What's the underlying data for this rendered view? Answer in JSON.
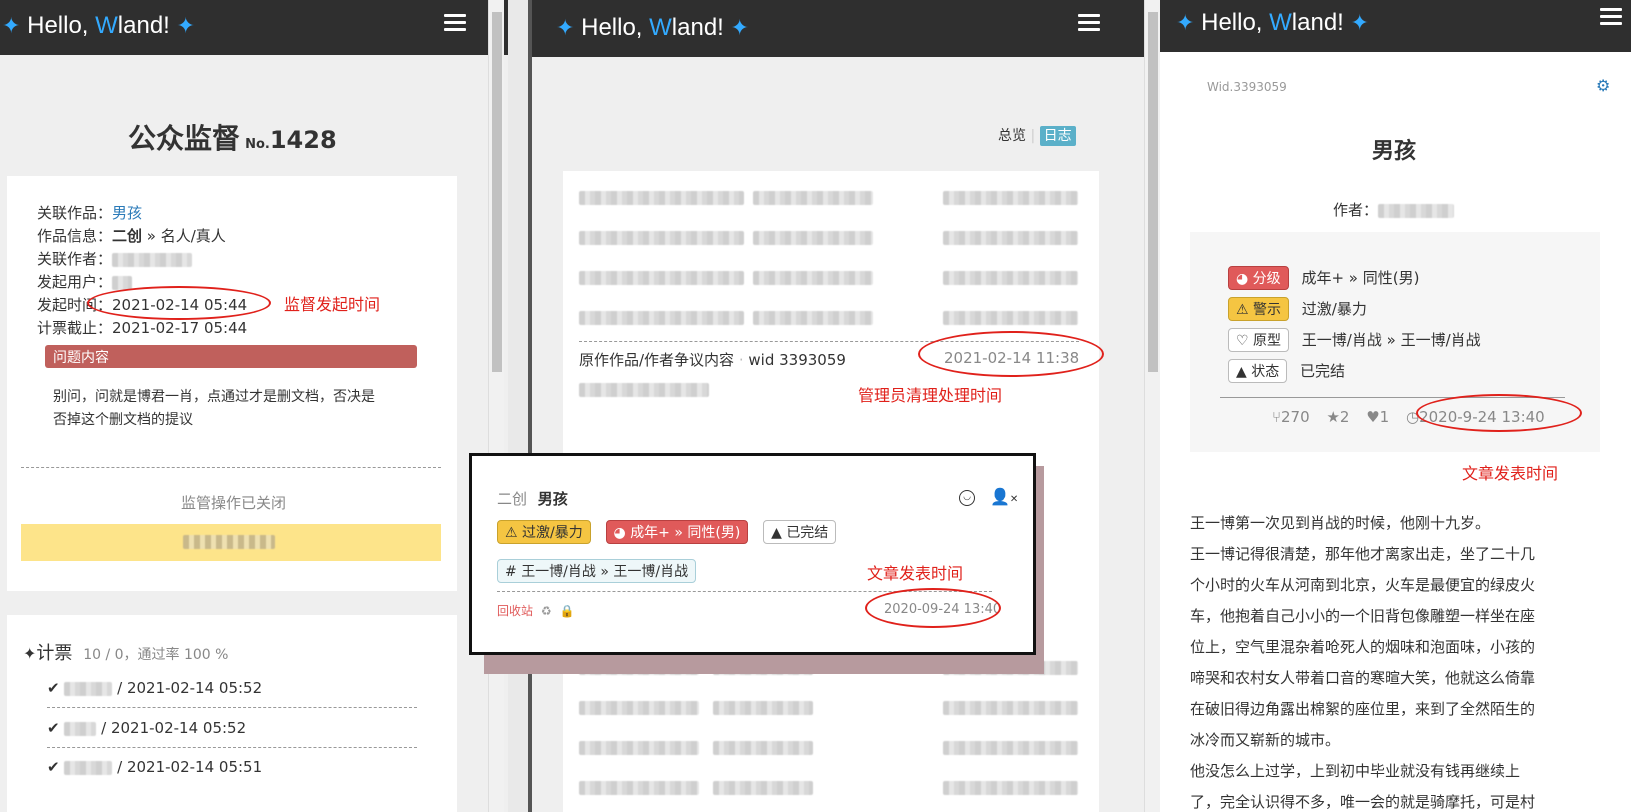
{
  "brand": {
    "hello": "Hello, ",
    "w": "W",
    "land": "land!",
    "star": "✦"
  },
  "left": {
    "title": "公众监督",
    "no_prefix": "No.",
    "no": "1428",
    "rows": [
      {
        "label": "关联作品：",
        "value": "男孩"
      },
      {
        "label": "作品信息：",
        "value": "二创",
        "extra": " » 名人/真人"
      },
      {
        "label": "关联作者：",
        "value": ""
      },
      {
        "label": "发起用户：",
        "value": ""
      },
      {
        "label": "发起时间：",
        "value": "2021-02-14 05:44"
      },
      {
        "label": "计票截止：",
        "value": "2021-02-17 05:44"
      }
    ],
    "annotation_start": "监督发起时间",
    "issue_header": "问题内容",
    "issue_text_1": "别问，问就是博君一肖，点通过才是删文档，否决是",
    "issue_text_2": "否掉这个删文档的提议",
    "closed_text": "监管操作已关闭",
    "vote_title": "计票",
    "vote_stats": "10 / 0，通过率 100 %",
    "votes": [
      {
        "time": "/ 2021-02-14 05:52"
      },
      {
        "time": "/ 2021-02-14 05:52"
      },
      {
        "time": "/ 2021-02-14 05:51"
      }
    ]
  },
  "middle": {
    "tab_overview": "总览",
    "tab_log": "日志",
    "log_entry": {
      "text": "原作作品/作者争议内容",
      "sep": "·",
      "wid": "wid 3393059",
      "time": "2021-02-14 11:38"
    },
    "annotation_admin": "管理员清理处理时间"
  },
  "popup": {
    "type": "二创",
    "title": "男孩",
    "tag_warn": "过激/暴力",
    "tag_rating": "成年+ » 同性(男)",
    "tag_status": "已完结",
    "tag_fandom": "王一博/肖战 » 王一博/肖战",
    "annotation": "文章发表时间",
    "recycle": "回收站",
    "time": "2020-09-24 13:40"
  },
  "right": {
    "wid": "Wid.3393059",
    "title": "男孩",
    "author_label": "作者：",
    "meta": [
      {
        "key": "分级",
        "value": "成年+ » 同性(男)",
        "icon": "pie-chart-icon"
      },
      {
        "key": "警示",
        "value": "过激/暴力",
        "icon": "warning-icon"
      },
      {
        "key": "原型",
        "value": "王一博/肖战 » 王一博/肖战",
        "icon": "heartbeat-icon"
      },
      {
        "key": "状态",
        "value": "已完结",
        "icon": "tree-icon"
      }
    ],
    "stats": {
      "views": "270",
      "stars": "2",
      "likes": "1",
      "time": "2020-9-24 13:40"
    },
    "annotation": "文章发表时间",
    "body": [
      "王一博第一次见到肖战的时候，他刚十九岁。",
      "王一博记得很清楚，那年他才离家出走，坐了二十几",
      "个小时的火车从河南到北京，火车是最便宜的绿皮火",
      "车，他抱着自己小小的一个旧背包像雕塑一样坐在座",
      "位上，空气里混杂着呛死人的烟味和泡面味，小孩的",
      "啼哭和农村女人带着口音的寒暄大笑，他就这么倚靠",
      "在破旧得边角露出棉絮的座位里，来到了全然陌生的",
      "冰冷而又崭新的城市。",
      "他没怎么上过学，上到初中毕业就没有钱再继续上",
      "了，完全认识得不多，唯一会的就是骑摩托，可是村"
    ]
  },
  "colors": {
    "accent": "#33aaff",
    "annotation": "#e0211b",
    "issue": "#c0605c",
    "closed": "#fde48a",
    "warn": "#f5c542",
    "rating": "#e05a5a"
  }
}
